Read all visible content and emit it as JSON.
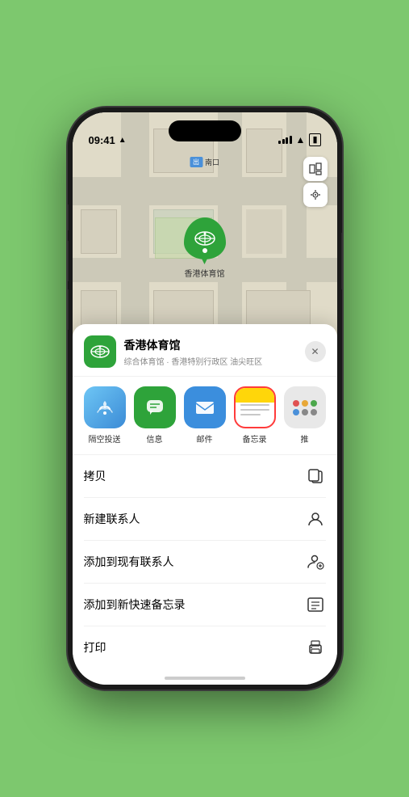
{
  "status_bar": {
    "time": "09:41",
    "location_arrow": "▶"
  },
  "map": {
    "label_sign": "南口",
    "sign_prefix": "出",
    "pin_label": "香港体育馆",
    "map_icon": "🗺",
    "location_icon": "➤"
  },
  "venue": {
    "name": "香港体育馆",
    "subtitle": "综合体育馆 · 香港特别行政区 油尖旺区",
    "close_label": "✕"
  },
  "share_items": [
    {
      "id": "airdrop",
      "label": "隔空投送"
    },
    {
      "id": "message",
      "label": "信息"
    },
    {
      "id": "mail",
      "label": "邮件"
    },
    {
      "id": "notes",
      "label": "备忘录"
    },
    {
      "id": "more",
      "label": "推"
    }
  ],
  "action_items": [
    {
      "id": "copy",
      "label": "拷贝",
      "icon": "copy"
    },
    {
      "id": "new-contact",
      "label": "新建联系人",
      "icon": "person"
    },
    {
      "id": "add-contact",
      "label": "添加到现有联系人",
      "icon": "person-add"
    },
    {
      "id": "quick-note",
      "label": "添加到新快速备忘录",
      "icon": "memo"
    },
    {
      "id": "print",
      "label": "打印",
      "icon": "print"
    }
  ]
}
